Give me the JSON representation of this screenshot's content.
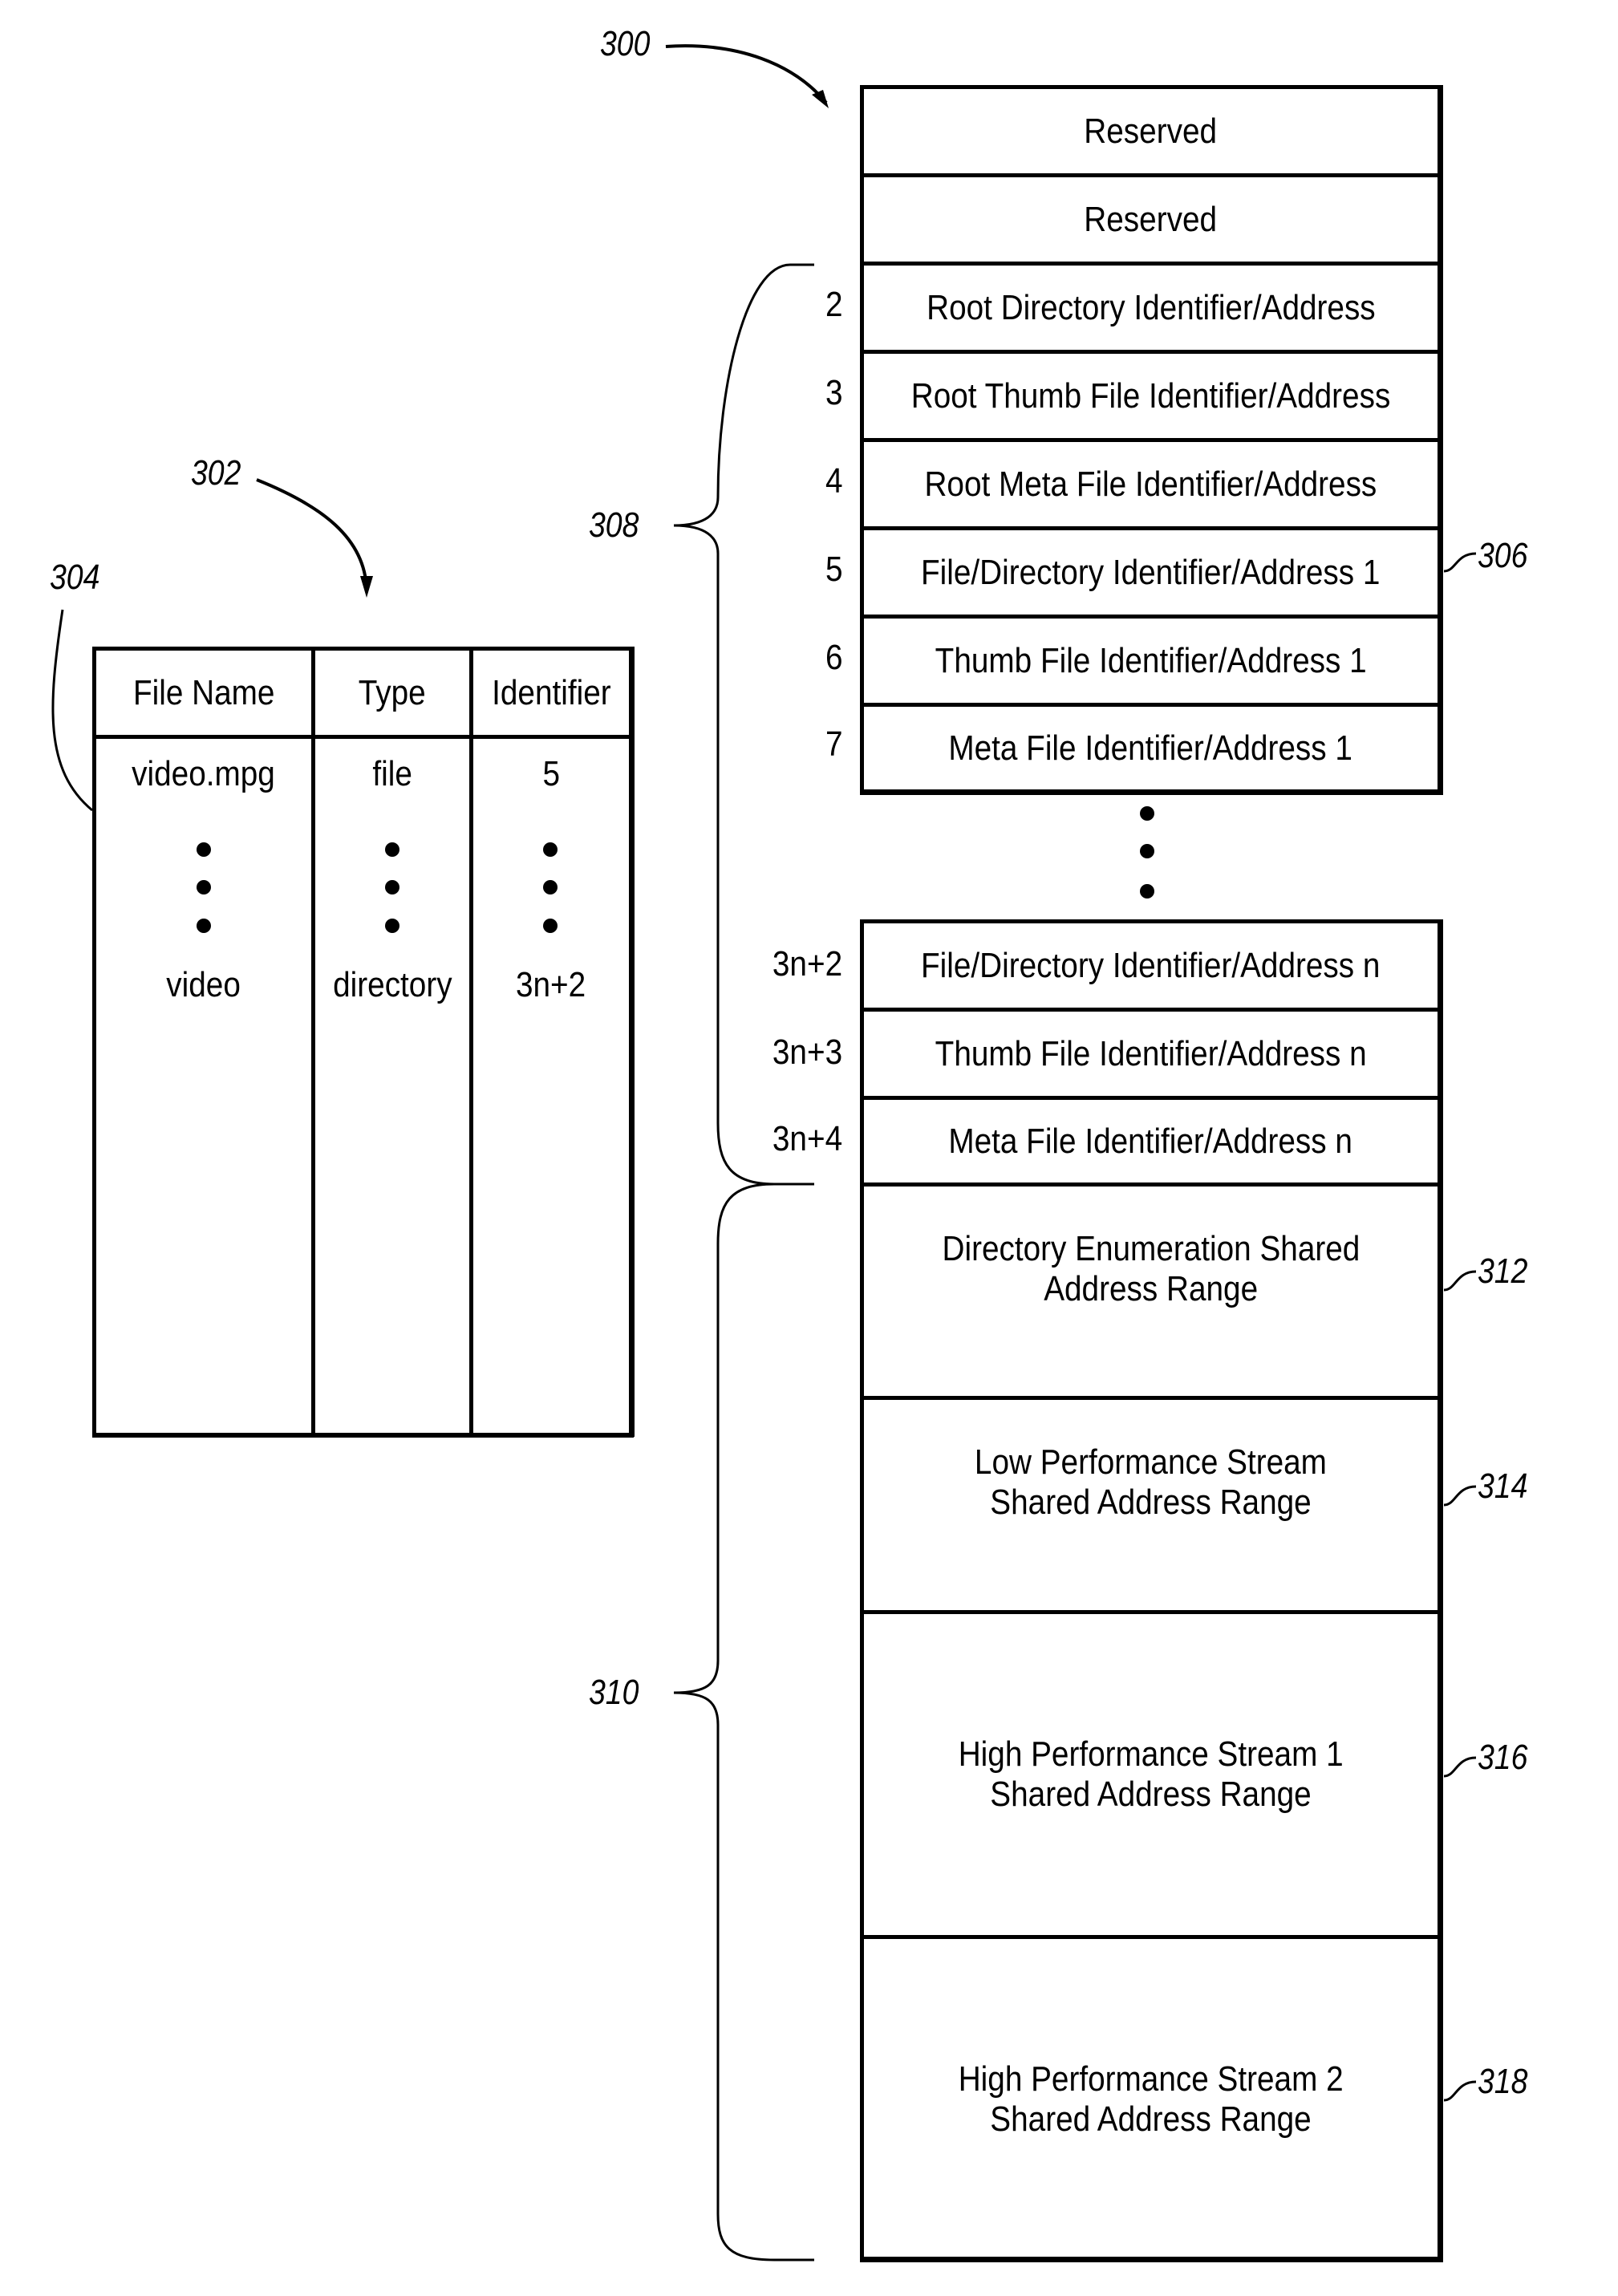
{
  "figure": {
    "reference_labels": {
      "memory_map": "300",
      "file_table": "302",
      "table_entries": "304",
      "entry_block": "306",
      "identifier_range": "308",
      "shared_range": "310",
      "directory_enumeration": "312",
      "low_performance": "314",
      "high_performance_1": "316",
      "high_performance_2": "318"
    },
    "file_table": {
      "headers": [
        "File Name",
        "Type",
        "Identifier"
      ],
      "rows": [
        [
          "video.mpg",
          "file",
          "5"
        ],
        [
          "video",
          "directory",
          "3n+2"
        ]
      ]
    },
    "memory_map": {
      "reserved": [
        "Reserved",
        "Reserved"
      ],
      "upper_rows": [
        {
          "index": "2",
          "label": "Root Directory Identifier/Address"
        },
        {
          "index": "3",
          "label": "Root Thumb File Identifier/Address"
        },
        {
          "index": "4",
          "label": "Root Meta File Identifier/Address"
        },
        {
          "index": "5",
          "label": "File/Directory Identifier/Address 1"
        },
        {
          "index": "6",
          "label": "Thumb File Identifier/Address 1"
        },
        {
          "index": "7",
          "label": "Meta File Identifier/Address 1"
        }
      ],
      "lower_rows": [
        {
          "index": "3n+2",
          "label": "File/Directory Identifier/Address n"
        },
        {
          "index": "3n+3",
          "label": "Thumb File Identifier/Address n"
        },
        {
          "index": "3n+4",
          "label": "Meta File Identifier/Address n"
        }
      ],
      "shared_ranges": [
        {
          "line1": "Directory Enumeration Shared",
          "line2": "Address Range"
        },
        {
          "line1": "Low Performance Stream",
          "line2": "Shared Address Range"
        },
        {
          "line1": "High Performance Stream 1",
          "line2": "Shared Address Range"
        },
        {
          "line1": "High Performance Stream 2",
          "line2": "Shared Address Range"
        }
      ]
    }
  }
}
